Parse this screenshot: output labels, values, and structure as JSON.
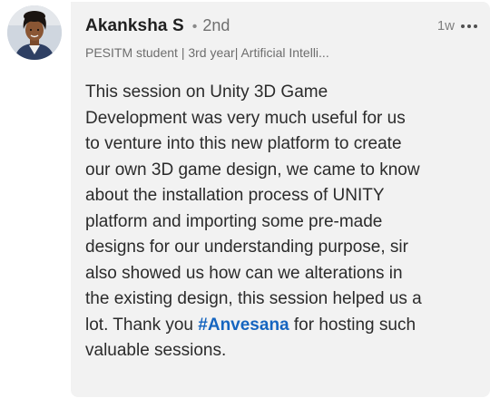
{
  "comment": {
    "author": "Akanksha S",
    "separator": "•",
    "degree": "2nd",
    "timestamp": "1w",
    "more_icon": "more-horizontal-icon",
    "headline": "PESITM student | 3rd year| Artificial Intelli...",
    "body_lines": [
      "This session on Unity 3D Game",
      "Development was very much useful for us",
      "to venture into this new platform to create",
      "our own 3D game design, we came to know",
      "about the installation process of UNITY",
      "platform and importing some pre-made",
      "designs for our understanding purpose, sir",
      "also showed us how can we alterations in",
      "the existing design, this session helped us a"
    ],
    "line_10_before": "lot. Thank you ",
    "hashtag": "#Anvesana",
    "line_10_after": " for hosting such",
    "line_11": "valuable sessions."
  },
  "colors": {
    "bubble_background": "#f2f2f2",
    "hashtag": "#1565c0",
    "name": "#1f1f1f",
    "secondary_text": "#6d6d6d"
  }
}
